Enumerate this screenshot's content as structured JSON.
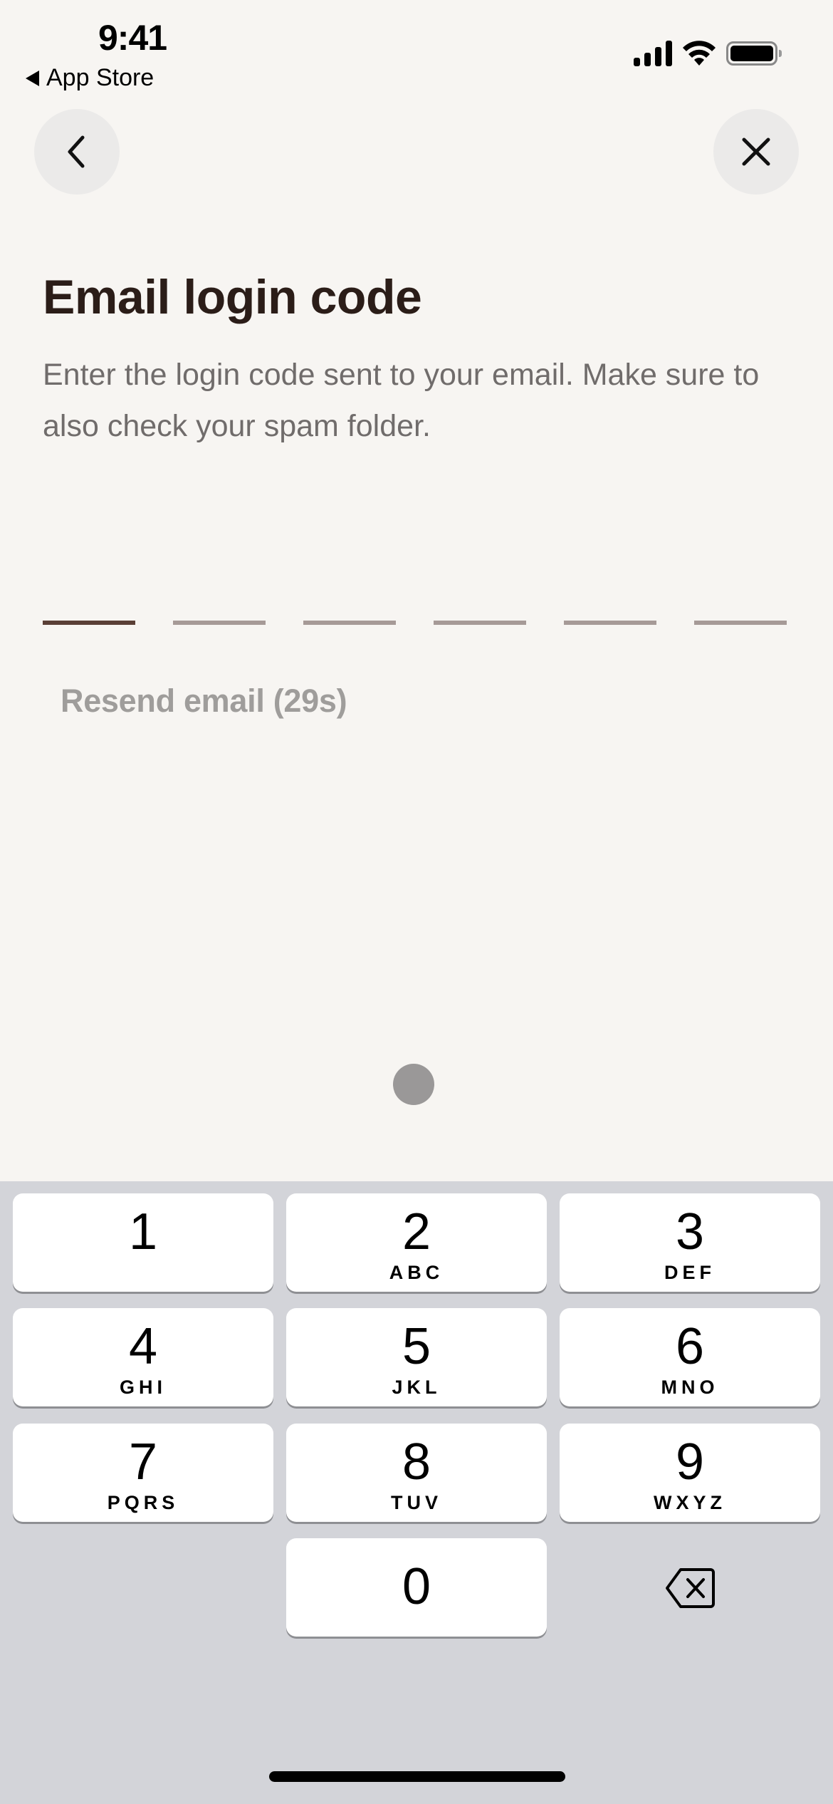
{
  "status_bar": {
    "time": "9:41",
    "back_app_label": "App Store",
    "icons": [
      "cellular-signal-icon",
      "wifi-icon",
      "battery-icon"
    ]
  },
  "nav": {
    "back_icon": "chevron-left-icon",
    "close_icon": "close-icon"
  },
  "page": {
    "title": "Email login code",
    "subtitle": "Enter the login code sent to your email. Make sure to also check your spam folder.",
    "code_length": 6,
    "active_slot": 1,
    "code_values": [
      "",
      "",
      "",
      "",
      "",
      ""
    ],
    "resend_label": "Resend email (29s)"
  },
  "colors": {
    "background": "#f7f5f2",
    "title": "#2b1d18",
    "subtitle": "#706c6b",
    "slot_active": "#5a3f36",
    "slot_inactive": "#a69a97",
    "resend_disabled": "#9f9d9b",
    "keyboard_bg": "#d3d4d9"
  },
  "keyboard": {
    "keys": [
      {
        "digit": "1",
        "letters": ""
      },
      {
        "digit": "2",
        "letters": "ABC"
      },
      {
        "digit": "3",
        "letters": "DEF"
      },
      {
        "digit": "4",
        "letters": "GHI"
      },
      {
        "digit": "5",
        "letters": "JKL"
      },
      {
        "digit": "6",
        "letters": "MNO"
      },
      {
        "digit": "7",
        "letters": "PQRS"
      },
      {
        "digit": "8",
        "letters": "TUV"
      },
      {
        "digit": "9",
        "letters": "WXYZ"
      },
      {
        "digit": "0",
        "letters": ""
      }
    ],
    "delete_icon": "backspace-icon"
  }
}
